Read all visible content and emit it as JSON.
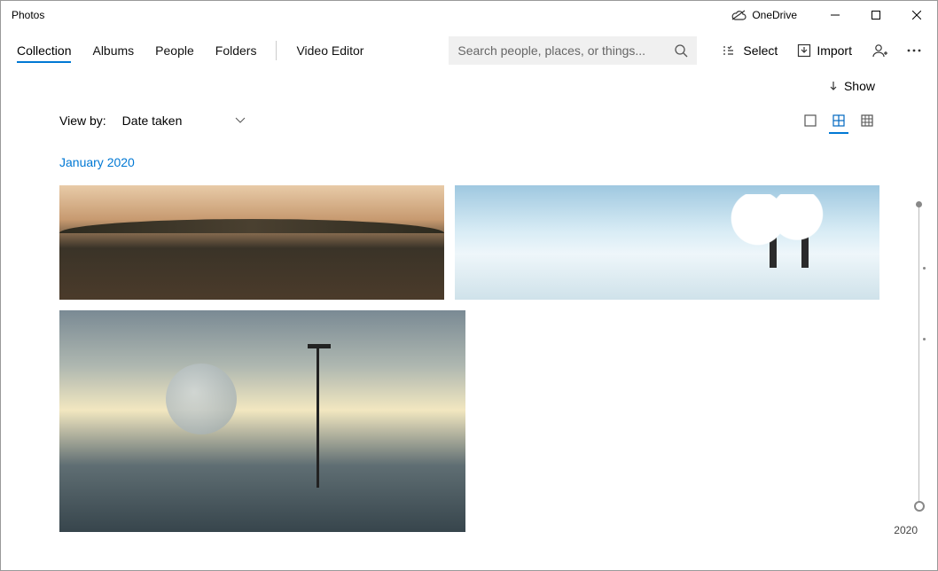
{
  "titlebar": {
    "app_title": "Photos",
    "onedrive_label": "OneDrive"
  },
  "nav": {
    "tabs": [
      "Collection",
      "Albums",
      "People",
      "Folders"
    ],
    "video_editor": "Video Editor",
    "active_index": 0
  },
  "search": {
    "placeholder": "Search people, places, or things..."
  },
  "toolbar": {
    "select_label": "Select",
    "import_label": "Import"
  },
  "subbar": {
    "show_label": "Show"
  },
  "viewby": {
    "label": "View by:",
    "value": "Date taken"
  },
  "viewmodes": {
    "active": "medium"
  },
  "group": {
    "header": "January 2020"
  },
  "timeline": {
    "year_label": "2020"
  }
}
